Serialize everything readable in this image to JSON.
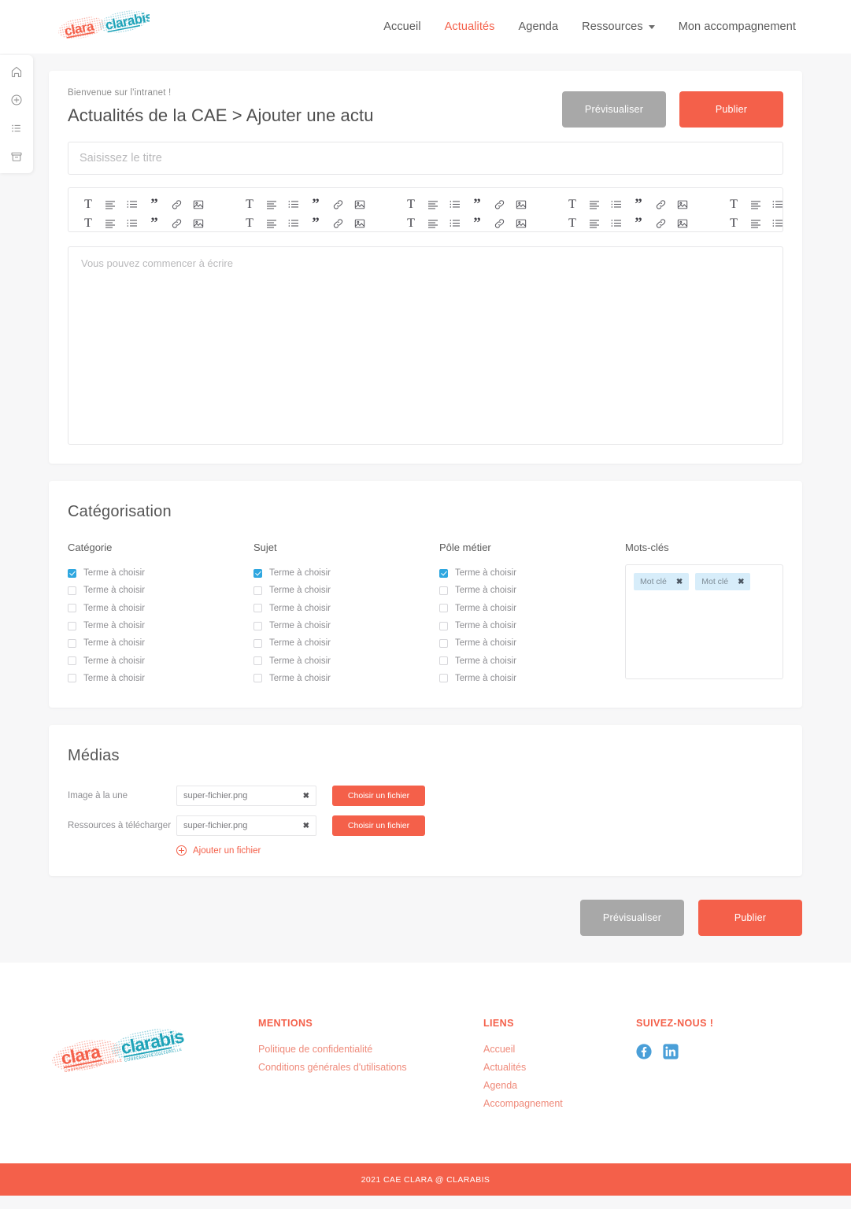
{
  "brand": {
    "logo_left_text": "clara",
    "logo_left_sub": "COOPERATIVE CULTURELLE",
    "logo_right_text": "clarabis",
    "logo_right_sub": "COOPERATIVE CULTURELLE",
    "accent_color": "#f4604a",
    "teal_color": "#1ea3b8",
    "checkbox_color": "#2fa7e0",
    "gray_button_color": "#a8a8a8",
    "chip_color": "#d7edfa",
    "social_color": "#55a8d8"
  },
  "nav": {
    "items": [
      {
        "label": "Accueil",
        "active": false,
        "dropdown": false
      },
      {
        "label": "Actualités",
        "active": true,
        "dropdown": false
      },
      {
        "label": "Agenda",
        "active": false,
        "dropdown": false
      },
      {
        "label": "Ressources",
        "active": false,
        "dropdown": true
      },
      {
        "label": "Mon accompagnement",
        "active": false,
        "dropdown": false
      }
    ]
  },
  "rail": {
    "items": [
      {
        "icon": "home-icon",
        "name": "sidebar-item-home"
      },
      {
        "icon": "plus-circle-icon",
        "name": "sidebar-item-add"
      },
      {
        "icon": "list-icon",
        "name": "sidebar-item-list"
      },
      {
        "icon": "archive-icon",
        "name": "sidebar-item-archive"
      }
    ]
  },
  "editor": {
    "welcome": "Bienvenue sur l'intranet !",
    "title": "Actualités de la CAE > Ajouter une actu",
    "preview_label": "Prévisualiser",
    "publish_label": "Publier",
    "title_input": {
      "value": "",
      "placeholder": "Saisissez le titre"
    },
    "body": {
      "value": "",
      "placeholder": "Vous pouvez commencer à écrire"
    },
    "toolbar": {
      "group_icons": [
        "text-icon",
        "align-left-icon",
        "bullet-list-icon",
        "quote-icon",
        "link-icon",
        "image-icon"
      ],
      "groups_per_row": 6,
      "rows": 2,
      "last_group_icons": [
        "text-icon",
        "align-left-icon",
        "bullet-list-icon",
        "quote-icon"
      ]
    }
  },
  "categorisation": {
    "title": "Catégorisation",
    "columns": [
      {
        "header": "Catégorie",
        "options": [
          {
            "label": "Terme à choisir",
            "checked": true
          },
          {
            "label": "Terme à choisir",
            "checked": false
          },
          {
            "label": "Terme à choisir",
            "checked": false
          },
          {
            "label": "Terme à choisir",
            "checked": false
          },
          {
            "label": "Terme à choisir",
            "checked": false
          },
          {
            "label": "Terme à choisir",
            "checked": false
          },
          {
            "label": "Terme à choisir",
            "checked": false
          }
        ]
      },
      {
        "header": "Sujet",
        "options": [
          {
            "label": "Terme à choisir",
            "checked": true
          },
          {
            "label": "Terme à choisir",
            "checked": false
          },
          {
            "label": "Terme à choisir",
            "checked": false
          },
          {
            "label": "Terme à choisir",
            "checked": false
          },
          {
            "label": "Terme à choisir",
            "checked": false
          },
          {
            "label": "Terme à choisir",
            "checked": false
          },
          {
            "label": "Terme à choisir",
            "checked": false
          }
        ]
      },
      {
        "header": "Pôle métier",
        "options": [
          {
            "label": "Terme à choisir",
            "checked": true
          },
          {
            "label": "Terme à choisir",
            "checked": false
          },
          {
            "label": "Terme à choisir",
            "checked": false
          },
          {
            "label": "Terme à choisir",
            "checked": false
          },
          {
            "label": "Terme à choisir",
            "checked": false
          },
          {
            "label": "Terme à choisir",
            "checked": false
          },
          {
            "label": "Terme à choisir",
            "checked": false
          }
        ]
      }
    ],
    "keywords": {
      "header": "Mots-clés",
      "chips": [
        {
          "label": "Mot clé",
          "remove": "✖"
        },
        {
          "label": "Mot clé",
          "remove": "✖"
        }
      ]
    }
  },
  "medias": {
    "title": "Médias",
    "rows": [
      {
        "label": "Image à la une",
        "file_name": "super-fichier.png",
        "remove": "✖",
        "button_label": "Choisir un fichier"
      },
      {
        "label": "Ressources à télécharger",
        "file_name": "super-fichier.png",
        "remove": "✖",
        "button_label": "Choisir un fichier"
      }
    ],
    "add_file_label": "Ajouter un fichier"
  },
  "bottom_actions": {
    "preview_label": "Prévisualiser",
    "publish_label": "Publier"
  },
  "footer": {
    "mentions": {
      "head": "MENTIONS",
      "links": [
        "Politique de confidentialité",
        "Conditions générales d'utilisations"
      ]
    },
    "liens": {
      "head": "LIENS",
      "links": [
        "Accueil",
        "Actualités",
        "Agenda",
        "Accompagnement"
      ]
    },
    "social": {
      "head": "SUIVEZ-NOUS !",
      "icons": [
        "facebook-icon",
        "linkedin-icon"
      ]
    },
    "copyright": "2021 CAE CLARA @ CLARABIS"
  }
}
